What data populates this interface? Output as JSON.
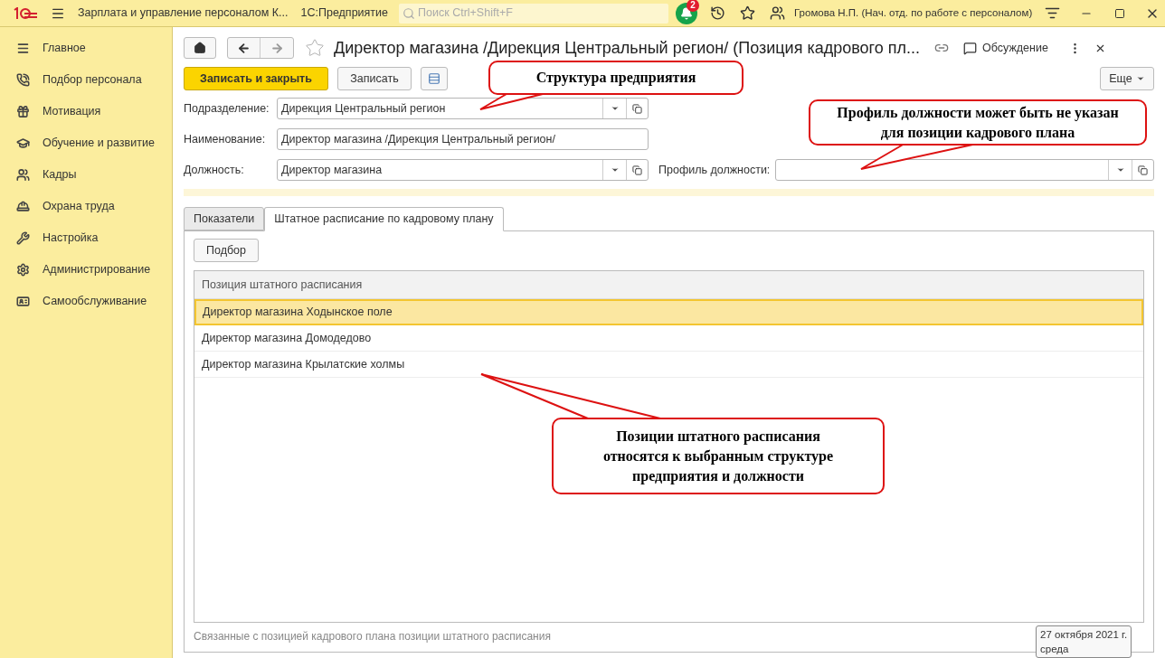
{
  "topbar": {
    "app_title": "Зарплата и управление персоналом К...",
    "platform": "1С:Предприятие",
    "search_placeholder": "Поиск Ctrl+Shift+F",
    "notifications": "2",
    "user": "Громова Н.П. (Нач. отд. по работе с персоналом)"
  },
  "sidebar": {
    "items": [
      {
        "label": "Главное"
      },
      {
        "label": "Подбор персонала"
      },
      {
        "label": "Мотивация"
      },
      {
        "label": "Обучение и развитие"
      },
      {
        "label": "Кадры"
      },
      {
        "label": "Охрана труда"
      },
      {
        "label": "Настройка"
      },
      {
        "label": "Администрирование"
      },
      {
        "label": "Самообслуживание"
      }
    ]
  },
  "form": {
    "title": "Директор магазина /Дирекция Центральный регион/ (Позиция кадрового пл...",
    "discussion": "Обсуждение",
    "buttons": {
      "save_close": "Записать и закрыть",
      "save": "Записать",
      "more": "Еще"
    },
    "fields": [
      {
        "label": "Подразделение:",
        "value": "Дирекция Центральный регион",
        "kind": "select"
      },
      {
        "label": "Наименование:",
        "value": "Директор магазина /Дирекция Центральный регион/",
        "kind": "text"
      },
      {
        "label": "Должность:",
        "value": "Директор магазина",
        "kind": "select"
      }
    ],
    "profile_label": "Профиль должности:",
    "tabs": [
      {
        "label": "Показатели",
        "selected": false
      },
      {
        "label": "Штатное расписание по кадровому плану",
        "selected": true
      }
    ],
    "pick_button": "Подбор",
    "table": {
      "column": "Позиция штатного расписания",
      "rows": [
        {
          "cell": "Директор магазина Ходынское поле",
          "selected": true
        },
        {
          "cell": "Директор магазина Домодедово",
          "selected": false
        },
        {
          "cell": "Директор магазина Крылатские холмы",
          "selected": false
        }
      ]
    },
    "footer_text": "Связанные с позицией кадрового плана позиции штатного расписания"
  },
  "tooltip": {
    "lines": [
      "27 октября 2021 г.",
      "среда"
    ]
  },
  "callouts": [
    {
      "text": "Структура предприятия"
    },
    {
      "text": "Профиль должности может быть не указан для позиции кадрового плана"
    },
    {
      "text": "Позиции штатного расписания относятся к выбранным структуре предприятия и должности"
    }
  ]
}
